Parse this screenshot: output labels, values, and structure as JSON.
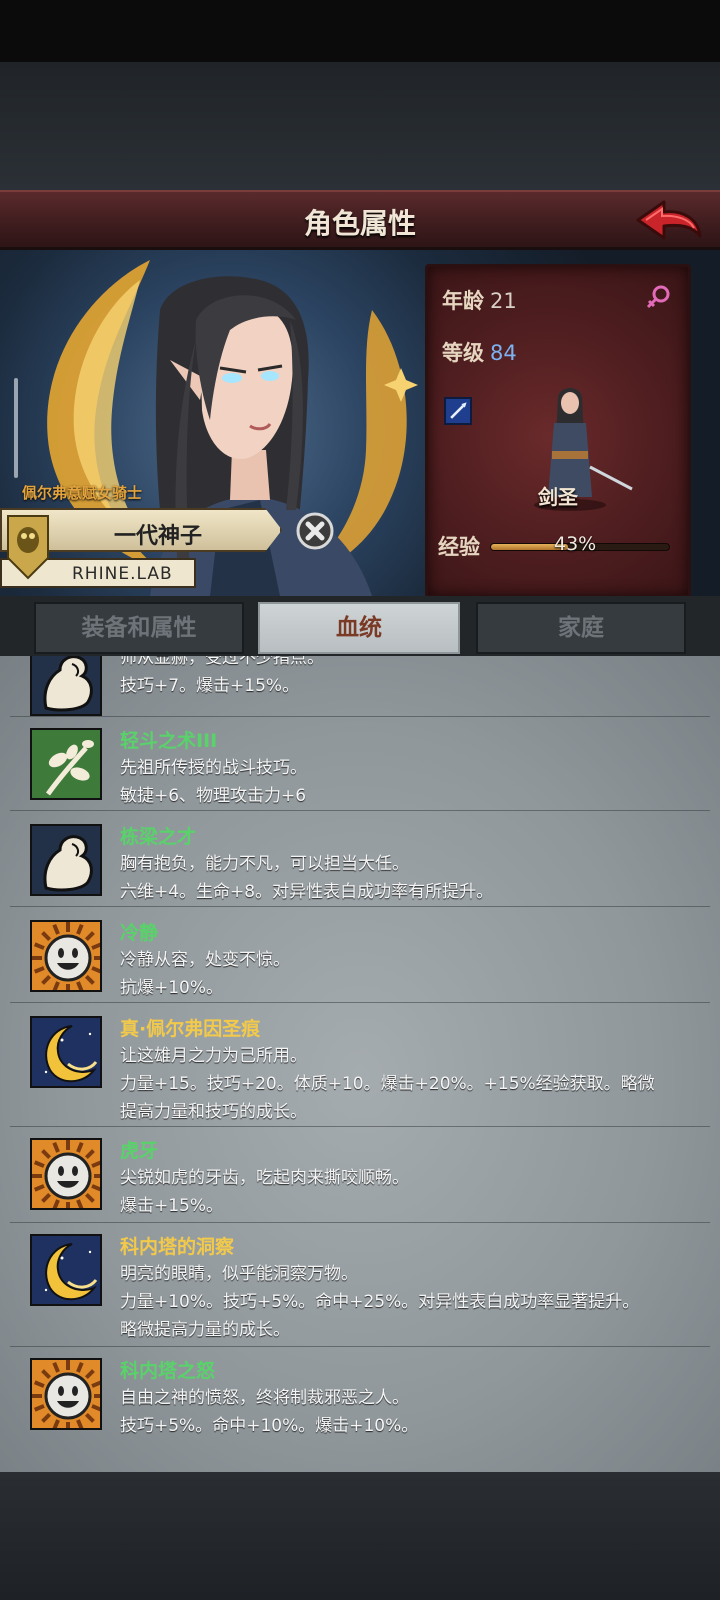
{
  "header": {
    "title": "角色属性",
    "back_icon": "back-arrow-icon"
  },
  "character": {
    "title_tag": "佩尔弗意赋女骑士",
    "name": "一代神子",
    "org": "RHINE.LAB",
    "class": "剑圣"
  },
  "stats": {
    "age_label": "年龄",
    "age": "21",
    "level_label": "等级",
    "level": "84",
    "exp_label": "经验",
    "exp_percent": 43,
    "exp_text": "43%",
    "gender_icon": "female-icon",
    "weapon_icon": "sword-icon"
  },
  "tabs": [
    {
      "label": "装备和属性",
      "active": false
    },
    {
      "label": "血统",
      "active": true
    },
    {
      "label": "家庭",
      "active": false
    }
  ],
  "traits": [
    {
      "name": "",
      "icon": "muscle-arm-icon",
      "desc": [
        "师从显赫，受过不少指点。",
        "技巧+7。爆击+15%。"
      ]
    },
    {
      "name": "轻斗之术III",
      "name_color": "#59d26a",
      "icon": "branch-icon",
      "desc": [
        "先祖所传授的战斗技巧。",
        "敏捷+6、物理攻击力+6"
      ]
    },
    {
      "name": "栋梁之才",
      "name_color": "#59d26a",
      "icon": "muscle-arm-icon",
      "desc": [
        "胸有抱负，能力不凡，可以担当大任。",
        "六维+4。生命+8。对异性表白成功率有所提升。"
      ]
    },
    {
      "name": "冷静",
      "name_color": "#59d26a",
      "icon": "smiley-sun-icon",
      "desc": [
        "冷静从容，处变不惊。",
        "抗爆+10%。"
      ]
    },
    {
      "name": "真·佩尔弗因圣痕",
      "name_color": "#f2c94a",
      "icon": "crescent-moon-icon",
      "desc": [
        "让这雄月之力为己所用。",
        "力量+15。技巧+20。体质+10。爆击+20%。+15%经验获取。略微",
        "提高力量和技巧的成长。"
      ]
    },
    {
      "name": "虎牙",
      "name_color": "#59d26a",
      "icon": "smiley-sun-icon",
      "desc": [
        "尖锐如虎的牙齿，吃起肉来撕咬顺畅。",
        "爆击+15%。"
      ]
    },
    {
      "name": "科内塔的洞察",
      "name_color": "#f2c94a",
      "icon": "crescent-moon-icon",
      "desc": [
        "明亮的眼睛，似乎能洞察万物。",
        "力量+10%。技巧+5%。命中+25%。对异性表白成功率显著提升。",
        "略微提高力量的成长。"
      ]
    },
    {
      "name": "科内塔之怒",
      "name_color": "#59d26a",
      "icon": "smiley-sun-icon",
      "desc": [
        "自由之神的愤怒，终将制裁邪恶之人。",
        "技巧+5%。命中+10%。爆击+10%。"
      ]
    }
  ]
}
